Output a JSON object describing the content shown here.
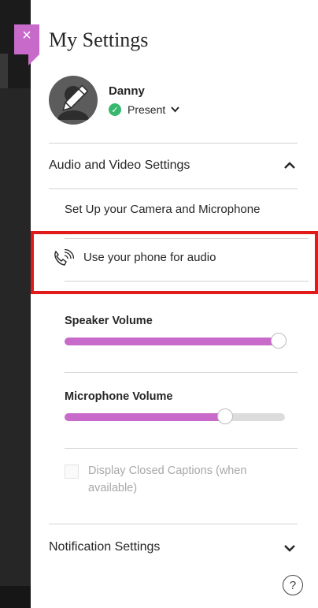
{
  "panel": {
    "title": "My Settings",
    "close_glyph": "×"
  },
  "user": {
    "name": "Danny",
    "status": "Present",
    "status_color": "#37b86f",
    "avatar_icon": "pencil-avatar-icon"
  },
  "audio_video": {
    "header": "Audio and Video Settings",
    "expanded": true,
    "setup_link": "Set Up your Camera and Microphone",
    "phone_audio": "Use your phone for audio",
    "speaker": {
      "label": "Speaker Volume",
      "level": 0.97
    },
    "microphone": {
      "label": "Microphone Volume",
      "level": 0.73
    },
    "captions": {
      "label": "Display Closed Captions (when available)",
      "checked": false,
      "enabled": false
    }
  },
  "notifications": {
    "header": "Notification Settings",
    "expanded": false
  },
  "help": {
    "glyph": "?"
  },
  "colors": {
    "accent": "#c86ac9",
    "highlight": "#e11a1a",
    "sidebar": "#262626"
  }
}
